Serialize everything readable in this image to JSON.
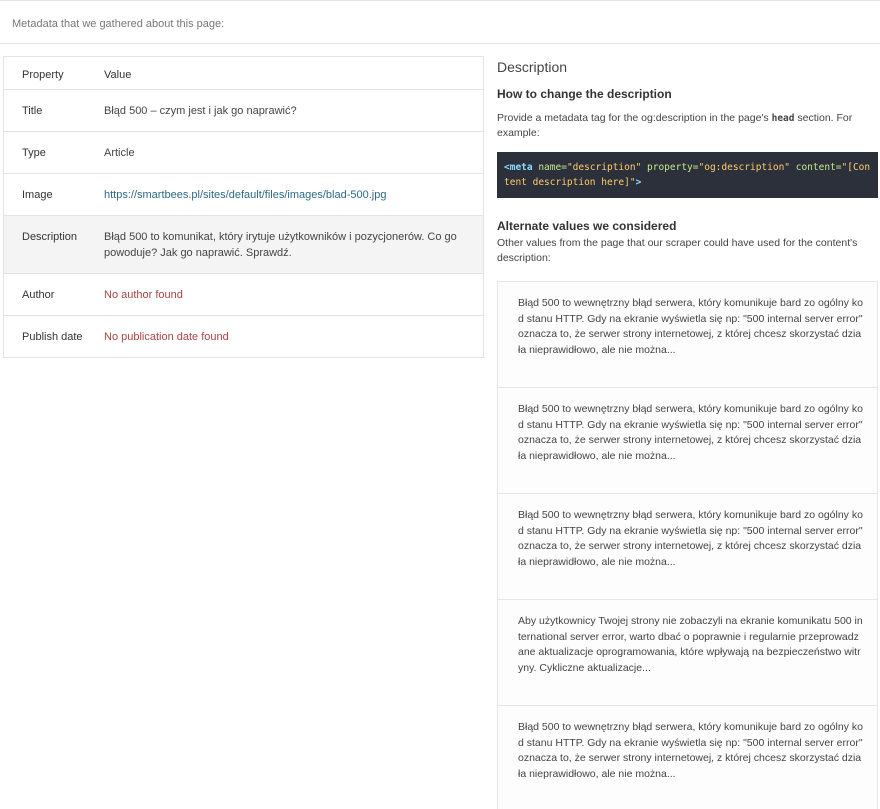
{
  "header": {
    "text": "Metadata that we gathered about this page:"
  },
  "table": {
    "head": {
      "property": "Property",
      "value": "Value"
    },
    "rows": [
      {
        "property": "Title",
        "value": "Błąd 500 – czym jest i jak go naprawić?"
      },
      {
        "property": "Type",
        "value": "Article"
      },
      {
        "property": "Image",
        "value": "https://smartbees.pl/sites/default/files/images/blad-500.jpg"
      },
      {
        "property": "Description",
        "value": "Błąd 500 to komunikat, który irytuje użytkowników i pozycjonerów. Co go powoduje? Jak go naprawić. Sprawdź."
      },
      {
        "property": "Author",
        "value": "No author found"
      },
      {
        "property": "Publish date",
        "value": "No publication date found"
      }
    ]
  },
  "right": {
    "section_title": "Description",
    "howto_title": "How to change the description",
    "howto_text_before": "Provide a metadata tag for the og:description in the page's ",
    "howto_text_bold": "head",
    "howto_text_after": " section. For example:",
    "code": {
      "tag_open": "<meta",
      "attr1": " name=",
      "val1": "\"description\"",
      "attr2": " property=",
      "val2": "\"og:description\"",
      "attr3": " content=",
      "val3": "\"[Content description here]\"",
      "tag_close": ">"
    },
    "alt_title": "Alternate values we considered",
    "alt_text": "Other values from the page that our scraper could have used for the content's description:",
    "alternates": [
      "Błąd 500 to wewnętrzny błąd serwera, który komunikuje bard zo ogólny kod stanu HTTP. Gdy na ekranie wyświetla się np: \"500 internal server error\" oznacza to, że serwer strony internetowej, z której chcesz skorzystać działa nieprawidłowo, ale nie można...",
      "Błąd 500 to wewnętrzny błąd serwera, który komunikuje bard zo ogólny kod stanu HTTP. Gdy na ekranie wyświetla się np: \"500 internal server error\" oznacza to, że serwer strony internetowej, z której chcesz skorzystać działa nieprawidłowo, ale nie można...",
      "Błąd 500 to wewnętrzny błąd serwera, który komunikuje bard zo ogólny kod stanu HTTP. Gdy na ekranie wyświetla się np: \"500 internal server error\" oznacza to, że serwer strony internetowej, z której chcesz skorzystać działa nieprawidłowo, ale nie można...",
      "Aby użytkownicy Twojej strony nie zobaczyli na ekranie komunikatu 500 international server error, warto dbać o poprawnie i regularnie przeprowadzane aktualizacje oprogramowania, które wpływają na bezpieczeństwo witryny. Cykliczne aktualizacje...",
      "Błąd 500 to wewnętrzny błąd serwera, który komunikuje bard zo ogólny kod stanu HTTP. Gdy na ekranie wyświetla się np: \"500 internal server error\" oznacza to, że serwer strony internetowej, z której chcesz skorzystać działa nieprawidłowo, ale nie można..."
    ]
  }
}
